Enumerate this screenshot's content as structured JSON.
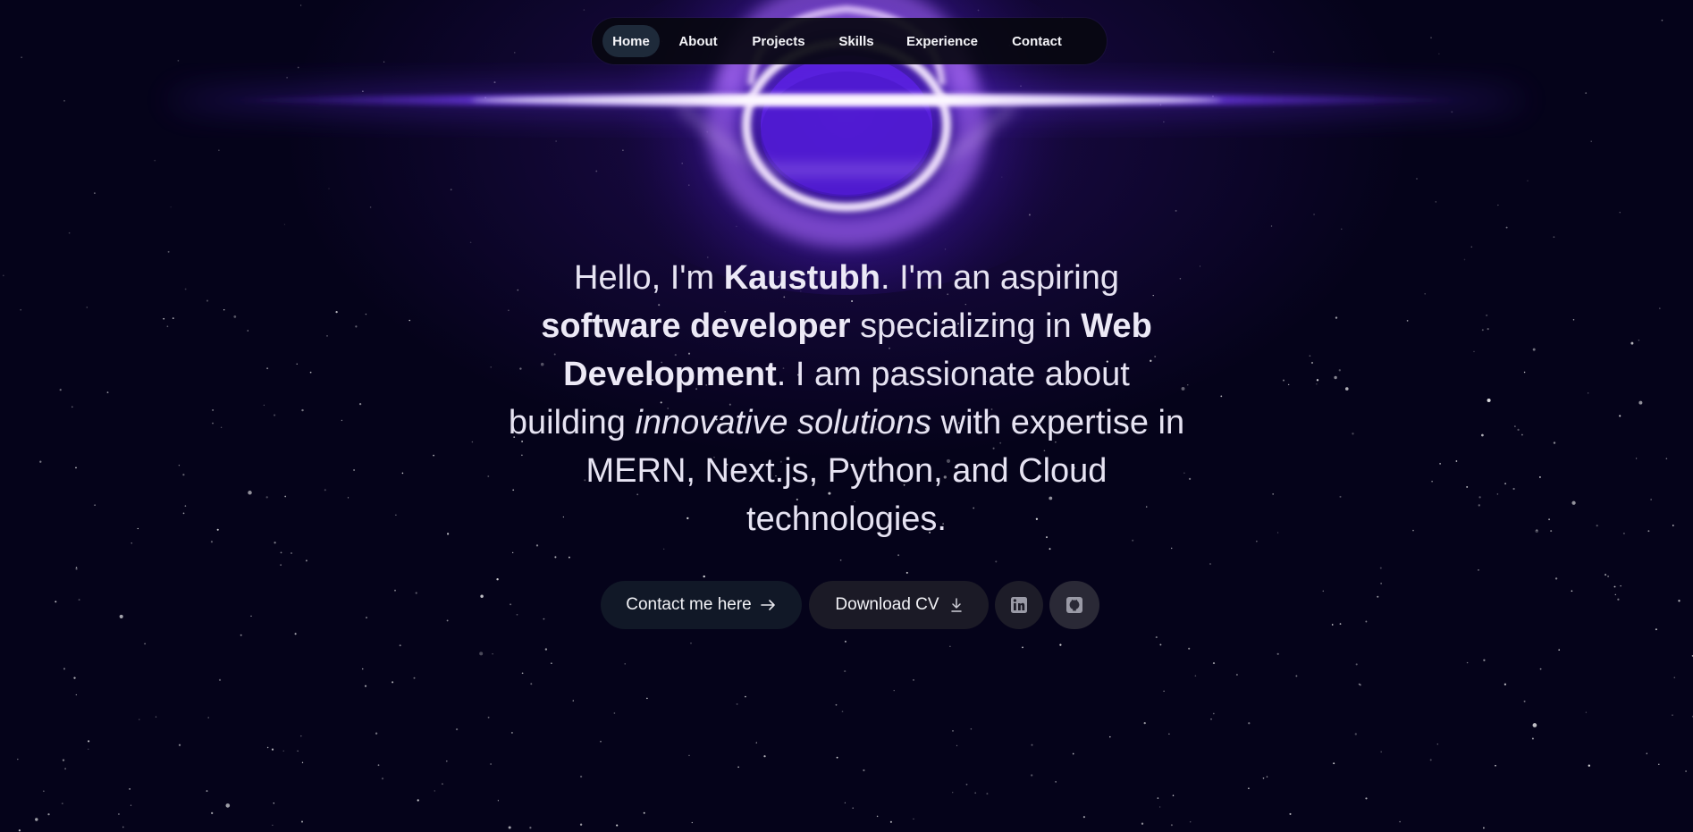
{
  "nav": {
    "items": [
      {
        "label": "Home",
        "active": true
      },
      {
        "label": "About",
        "active": false
      },
      {
        "label": "Projects",
        "active": false
      },
      {
        "label": "Skills",
        "active": false
      },
      {
        "label": "Experience",
        "active": false
      },
      {
        "label": "Contact",
        "active": false
      }
    ]
  },
  "hero": {
    "greeting": "Hello, I'm ",
    "name": "Kaustubh",
    "after_name": ". I'm an aspiring ",
    "role": "software developer",
    "mid": " specializing in ",
    "field": "Web Development",
    "after_field": ". I am passionate about building ",
    "emphasis": "innovative solutions",
    "end": " with expertise in MERN, Next.js, Python, and Cloud technologies."
  },
  "actions": {
    "contact_label": "Contact me here",
    "contact_icon": "arrow-right-icon",
    "cv_label": "Download CV",
    "cv_icon": "download-icon",
    "linkedin_icon": "linkedin-icon",
    "github_icon": "github-icon"
  },
  "colors": {
    "background": "#05031a",
    "accent": "#7b3cff",
    "glow": "#f0d8ff",
    "nav_active": "#1e2a3a",
    "text": "#e6e3f2"
  }
}
